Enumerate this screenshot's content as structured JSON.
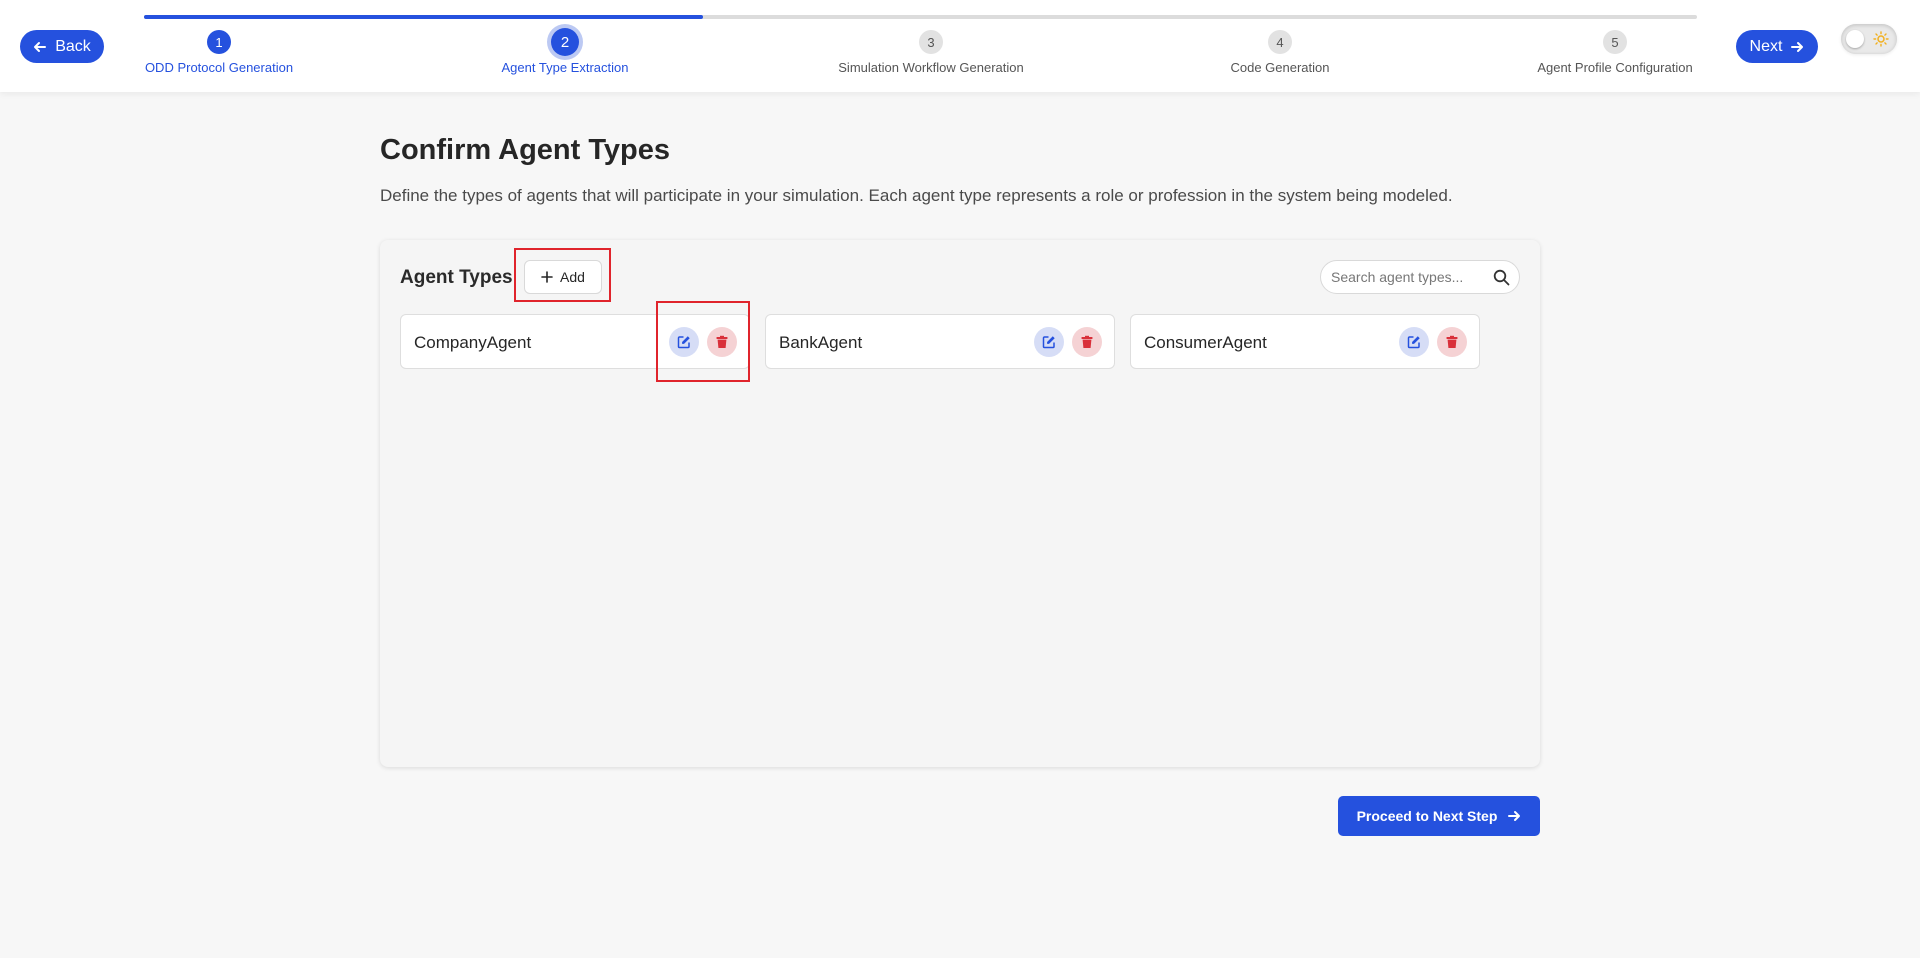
{
  "nav": {
    "back_label": "Back",
    "next_label": "Next",
    "back_icon": "arrow-left-icon",
    "next_icon": "arrow-right-icon"
  },
  "progress": {
    "completed_fraction": 0.36,
    "steps": [
      {
        "number": "1",
        "label": "ODD Protocol Generation",
        "state": "done"
      },
      {
        "number": "2",
        "label": "Agent Type Extraction",
        "state": "active"
      },
      {
        "number": "3",
        "label": "Simulation Workflow Generation",
        "state": "pending"
      },
      {
        "number": "4",
        "label": "Code Generation",
        "state": "pending"
      },
      {
        "number": "5",
        "label": "Agent Profile Configuration",
        "state": "pending"
      }
    ]
  },
  "theme_toggle": {
    "icon": "sun-icon",
    "mode": "light"
  },
  "page": {
    "title": "Confirm Agent Types",
    "description": "Define the types of agents that will participate in your simulation. Each agent type represents a role or profession in the system being modeled."
  },
  "agent_panel": {
    "title": "Agent Types",
    "add_label": "Add",
    "search_placeholder": "Search agent types...",
    "search_value": "",
    "agents": [
      {
        "name": "CompanyAgent"
      },
      {
        "name": "BankAgent"
      },
      {
        "name": "ConsumerAgent"
      }
    ]
  },
  "footer": {
    "proceed_label": "Proceed to Next Step"
  },
  "colors": {
    "accent": "#2551de",
    "delete": "#d9303a",
    "highlight": "#e0242c"
  }
}
